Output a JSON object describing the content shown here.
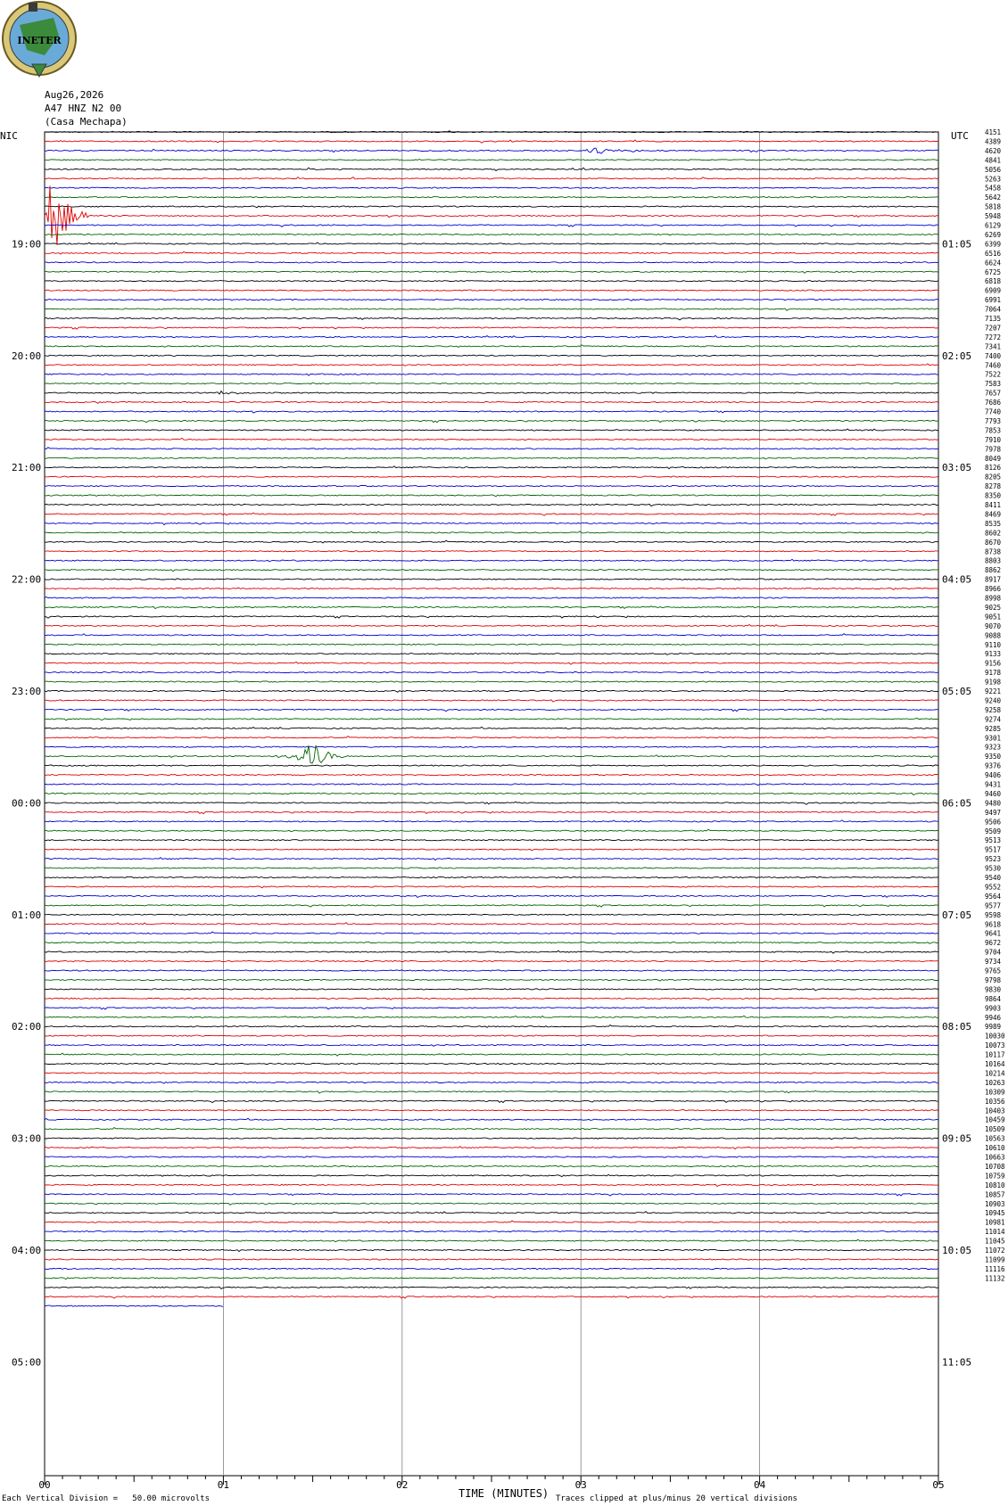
{
  "header": {
    "date": "Aug26,2026",
    "station": "A47 HNZ N2 00",
    "site": "(Casa Mechapa)",
    "logo_text": "INETER"
  },
  "corners": {
    "left": "NIC",
    "right": "UTC"
  },
  "footer": {
    "division": "Each Vertical Division =   50.00 microvolts",
    "xlabel": "TIME (MINUTES)",
    "clip_note": "Traces clipped at plus/minus 20 vertical divisions"
  },
  "colors": {
    "black": "#000000",
    "red": "#e00000",
    "blue": "#0000d0",
    "green": "#006400",
    "grid": "#808080"
  },
  "chart_data": {
    "type": "line",
    "title": "",
    "xlabel": "TIME (MINUTES)",
    "x_range": [
      0,
      5
    ],
    "x_ticks": [
      "00",
      "01",
      "02",
      "03",
      "04",
      "05"
    ],
    "trace_minutes": 5,
    "trace_count": 127,
    "last_trace_end_minute": 1.0,
    "trace_color_cycle": [
      "black",
      "red",
      "blue",
      "green"
    ],
    "left_time_labels": [
      "19:00",
      "20:00",
      "21:00",
      "22:00",
      "23:00",
      "00:00",
      "01:00",
      "02:00",
      "03:00",
      "04:00",
      "05:00"
    ],
    "right_time_labels": [
      "01:05",
      "02:05",
      "03:05",
      "04:05",
      "05:05",
      "06:05",
      "07:05",
      "08:05",
      "09:05",
      "10:05",
      "11:05"
    ],
    "right_values": [
      "4151",
      "4389",
      "4620",
      "4841",
      "5056",
      "5263",
      "5458",
      "5642",
      "5818",
      "5948",
      "6129",
      "6269",
      "6399",
      "6516",
      "6624",
      "6725",
      "6818",
      "6909",
      "6991",
      "7064",
      "7135",
      "7207",
      "7272",
      "7341",
      "7400",
      "7460",
      "7522",
      "7583",
      "7657",
      "7686",
      "7740",
      "7793",
      "7853",
      "7910",
      "7978",
      "8049",
      "8126",
      "8205",
      "8278",
      "8350",
      "8411",
      "8469",
      "8535",
      "8602",
      "8670",
      "8738",
      "8803",
      "8862",
      "8917",
      "8966",
      "8998",
      "9025",
      "9051",
      "9070",
      "9088",
      "9110",
      "9133",
      "9156",
      "9178",
      "9198",
      "9221",
      "9240",
      "9258",
      "9274",
      "9285",
      "9301",
      "9323",
      "9350",
      "9376",
      "9406",
      "9431",
      "9460",
      "9480",
      "9497",
      "9506",
      "9509",
      "9513",
      "9517",
      "9523",
      "9530",
      "9540",
      "9552",
      "9564",
      "9577",
      "9598",
      "9618",
      "9641",
      "9672",
      "9704",
      "9734",
      "9765",
      "9798",
      "9830",
      "9864",
      "9903",
      "9946",
      "9989",
      "10030",
      "10073",
      "10117",
      "10164",
      "10214",
      "10263",
      "10309",
      "10356",
      "10403",
      "10459",
      "10509",
      "10563",
      "10610",
      "10663",
      "10708",
      "10759",
      "10810",
      "10857",
      "10903",
      "10945",
      "10981",
      "11014",
      "11045",
      "11072",
      "11099",
      "11116",
      "11132"
    ],
    "events": [
      {
        "trace": 9,
        "minute": 0.05,
        "amplitude_divisions": 20,
        "color": "red",
        "note": "clipped"
      },
      {
        "trace": 67,
        "minute": 1.5,
        "amplitude_divisions": 7,
        "color": "green"
      },
      {
        "trace": 28,
        "minute": 1.0,
        "amplitude_divisions": 1.2,
        "color": "black"
      },
      {
        "trace": 2,
        "minute": 3.1,
        "amplitude_divisions": 1.8,
        "color": "blue"
      }
    ]
  }
}
